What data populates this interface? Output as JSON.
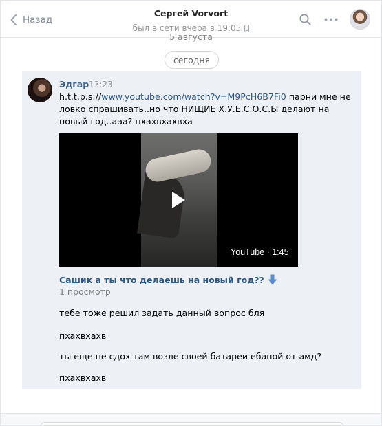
{
  "header": {
    "back_label": "Назад",
    "peer_name": "Сергей Vorvort",
    "peer_status": "был в сети вчера в 19:05"
  },
  "history": {
    "prev_date": "5 августа",
    "date_separator": "сегодня"
  },
  "message": {
    "author": "Эдгар",
    "time": "13:23",
    "text_prefix": "h.t.t.p.s://",
    "link": "www.youtube.com/watch?v=M9PcH6B7Fi0",
    "text_rest": " парни мне не ловко спрашивать..но что НИЩИЕ Х.У.Е.С.О.С.Ы делают на новый год..ааа? пхахвхахвха",
    "video": {
      "badge": "YouTube · 1:45",
      "title": "Сашик а ты что делаешь на новый год??",
      "views": "1 просмотр"
    },
    "followups": [
      "тебе тоже решил задать данный вопрос бля",
      "пхахвхахв",
      "ты еще не сдох там возле своей батареи ебаной от амд?",
      "пхахвхахв"
    ]
  },
  "colors": {
    "accent": "#2a5885",
    "author": "#42648b",
    "message_bg": "#edf0f5"
  },
  "icons": {
    "back": "chevron-left-icon",
    "phone": "phone-icon",
    "search": "search-icon",
    "more": "more-icon",
    "play": "play-icon",
    "arrow": "down-arrow-icon"
  }
}
